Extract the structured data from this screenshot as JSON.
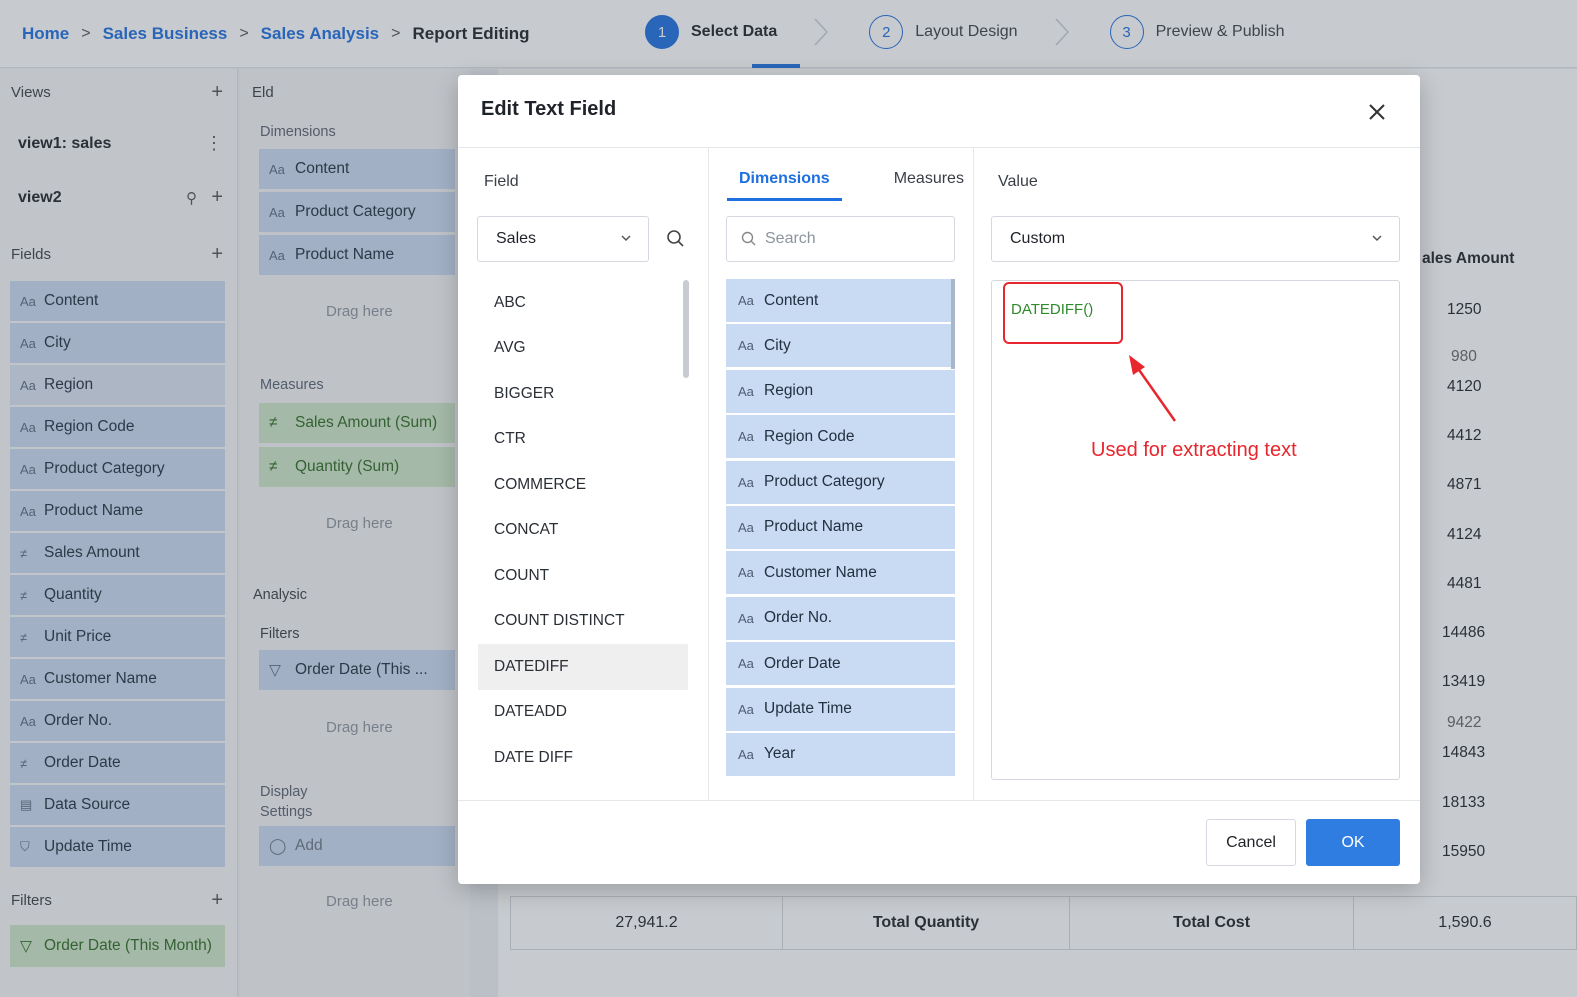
{
  "breadcrumb": {
    "home": "Home",
    "sales_business": "Sales Business",
    "sales_analysis": "Sales Analysis",
    "current": "Report Editing"
  },
  "steps": [
    {
      "num": "1",
      "label": "Select Data"
    },
    {
      "num": "2",
      "label": "Layout Design"
    },
    {
      "num": "3",
      "label": "Preview & Publish"
    }
  ],
  "left": {
    "views_title": "Views",
    "views": [
      "view1: sales",
      "view2"
    ],
    "fields_title": "Fields",
    "fields": [
      {
        "icon": "Aa",
        "label": "Content"
      },
      {
        "icon": "Aa",
        "label": "City"
      },
      {
        "icon": "Aa",
        "label": "Region"
      },
      {
        "icon": "Aa",
        "label": "Region Code"
      },
      {
        "icon": "Aa",
        "label": "Product Category"
      },
      {
        "icon": "Aa",
        "label": "Product Name"
      },
      {
        "icon": "measure-icon",
        "label": "Sales Amount"
      },
      {
        "icon": "measure-icon",
        "label": "Quantity"
      },
      {
        "icon": "measure-icon",
        "label": "Unit Price"
      },
      {
        "icon": "Aa",
        "label": "Customer Name"
      },
      {
        "icon": "Aa",
        "label": "Order No."
      },
      {
        "icon": "measure-icon",
        "label": "Order Date"
      },
      {
        "icon": "database-icon",
        "label": "Data Source"
      },
      {
        "icon": "lock-icon",
        "label": "Update Time"
      }
    ],
    "filters_title": "Filters",
    "filter_pill": "Order Date (This Month)"
  },
  "middle": {
    "title": "Eld",
    "dimensions_label": "Dimensions",
    "dimensions": [
      "Content",
      "Product Category",
      "Product Name"
    ],
    "measures_label": "Measures",
    "measures": [
      "Sales Amount (Sum)",
      "Quantity (Sum)"
    ],
    "analysis_label": "Analysic",
    "filters_label": "Filters",
    "filter_pill": "Order Date (This ...",
    "display_label_1": "Display",
    "display_label_2": "Settings",
    "add_label": "Add",
    "drag_here": "Drag here"
  },
  "table": {
    "column_header": "ales Amount",
    "values": [
      "1250",
      "980",
      "4120",
      "4412",
      "4871",
      "4124",
      "4481",
      "14486",
      "13419",
      "9422",
      "14843",
      "18133",
      "15950"
    ],
    "totals": {
      "value": "27,941.2",
      "qty_label": "Total Quantity",
      "cost_label": "Total Cost",
      "cost_value": "1,590.6"
    }
  },
  "modal": {
    "title": "Edit Text Field",
    "field_label": "Field",
    "field_select": "Sales",
    "functions": [
      "ABC",
      "AVG",
      "BIGGER",
      "CTR",
      "COMMERCE",
      "CONCAT",
      "COUNT",
      "COUNT DISTINCT",
      "DATEDIFF",
      "DATEADD",
      "DATE DIFF"
    ],
    "highlighted_function": "DATEDIFF",
    "tab_dimensions": "Dimensions",
    "tab_measures": "Measures",
    "search_placeholder": "Search",
    "dimension_items": [
      "Content",
      "City",
      "Region",
      "Region Code",
      "Product Category",
      "Product Name",
      "Customer Name",
      "Order No.",
      "Order Date",
      "Update Time",
      "Year"
    ],
    "value_label": "Value",
    "value_select": "Custom",
    "formula": "DATEDIFF()",
    "annotation": "Used for extracting text",
    "cancel": "Cancel",
    "ok": "OK"
  },
  "colors": {
    "accent": "#1e6fe0",
    "annotation_red": "#e8262d",
    "formula_green": "#2f8a2c",
    "dimension_pill": "#c9daf3",
    "measure_pill": "#cfe7c9"
  }
}
